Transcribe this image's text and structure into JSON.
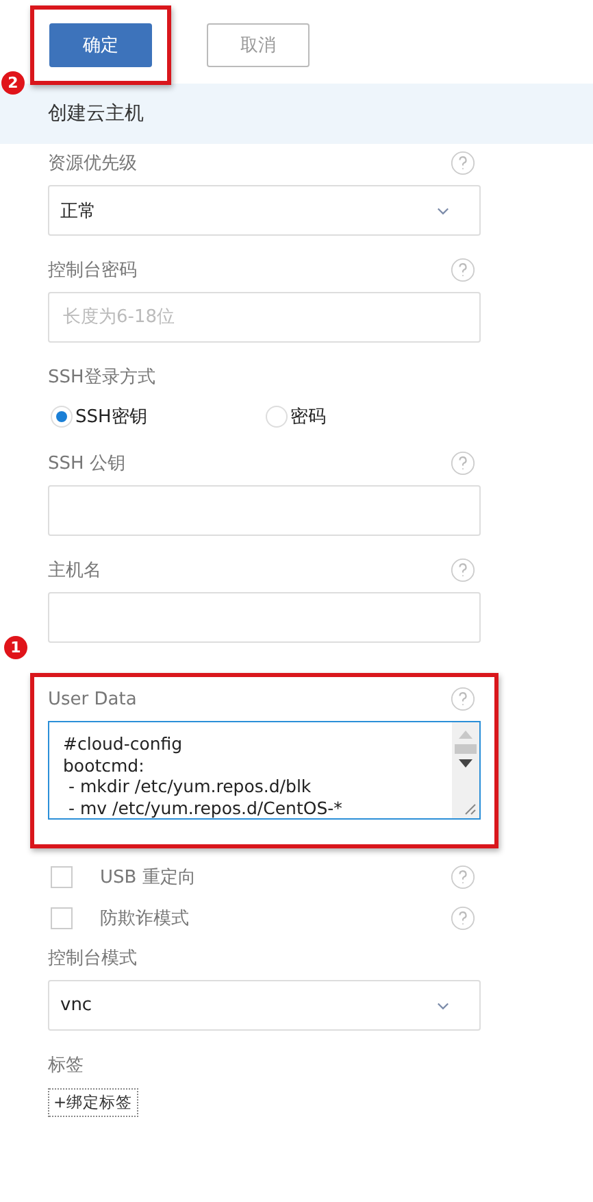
{
  "actions": {
    "badge": "2",
    "buttons": [
      {
        "label": "确定",
        "kind": "primary",
        "highlighted": true
      },
      {
        "label": "取消",
        "kind": "secondary",
        "highlighted": false
      }
    ]
  },
  "header": {
    "title": "创建云主机"
  },
  "fields": [
    {
      "kind": "select",
      "label": "资源优先级",
      "value": "正常",
      "help": true
    },
    {
      "kind": "input",
      "label": "控制台密码",
      "placeholder": "长度为6-18位",
      "help": true
    },
    {
      "kind": "radio",
      "label": "SSH登录方式",
      "options": [
        {
          "label": "SSH密钥",
          "selected": true
        },
        {
          "label": "密码",
          "selected": false
        }
      ]
    },
    {
      "kind": "input",
      "label": "SSH 公钥",
      "help": true
    },
    {
      "kind": "input",
      "label": "主机名",
      "help": true
    },
    {
      "kind": "textarea",
      "label": "User Data",
      "help": true,
      "highlighted": true,
      "badge": "1",
      "lines": [
        "#cloud-config",
        "bootcmd:",
        " - mkdir /etc/yum.repos.d/blk",
        " - mv /etc/yum.repos.d/CentOS-*"
      ]
    },
    {
      "kind": "checkbox",
      "label": "USB 重定向",
      "checked": false,
      "help": true
    },
    {
      "kind": "checkbox",
      "label": "防欺诈模式",
      "checked": false,
      "help": true
    },
    {
      "kind": "select",
      "label": "控制台模式",
      "value": "vnc"
    },
    {
      "kind": "tags",
      "label": "标签",
      "button": "+绑定标签"
    }
  ]
}
